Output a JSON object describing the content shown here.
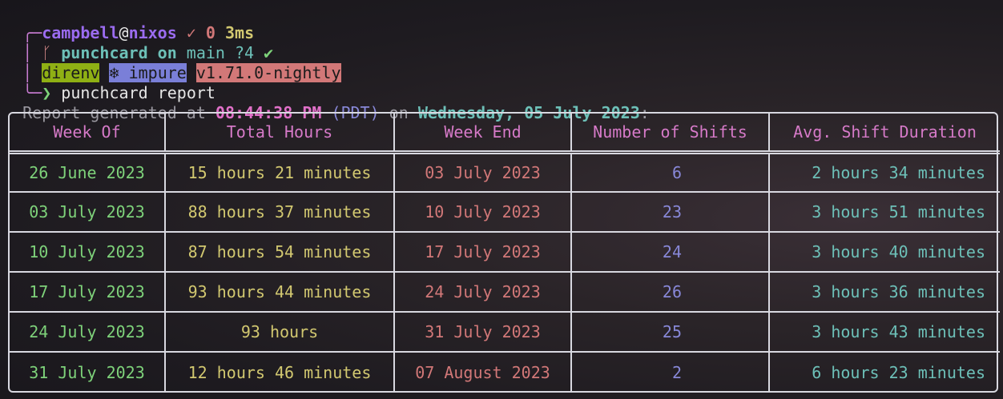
{
  "prompt": {
    "user": "campbell",
    "at": "@",
    "host": "nixos",
    "status_check": "✓",
    "exit_code": "0",
    "duration": "3ms",
    "branch_icon": "branch-icon",
    "dir": "punchcard",
    "on": "on",
    "branch": "main",
    "git_status": "?4",
    "git_clean": "✔",
    "tag_direnv": "direnv",
    "tag_nix_icon": "❄",
    "tag_nix": "impure",
    "tag_version": "v1.71.0-nightly",
    "arrow": "❯",
    "command": "punchcard report"
  },
  "report": {
    "prefix": "Report generated at ",
    "time": "08:44:38 PM",
    "tz": "(PDT)",
    "on": " on ",
    "date": "Wednesday, 05 July 2023",
    "colon": ":"
  },
  "table": {
    "headers": [
      "Week Of",
      "Total Hours",
      "Week End",
      "Number of Shifts",
      "Avg. Shift Duration"
    ],
    "rows": [
      [
        "26 June 2023",
        "15 hours 21 minutes",
        "03 July 2023",
        "6",
        "2 hours 34 minutes"
      ],
      [
        "03 July 2023",
        "88 hours 37 minutes",
        "10 July 2023",
        "23",
        "3 hours 51 minutes"
      ],
      [
        "10 July 2023",
        "87 hours 54 minutes",
        "17 July 2023",
        "24",
        "3 hours 40 minutes"
      ],
      [
        "17 July 2023",
        "93 hours 44 minutes",
        "24 July 2023",
        "26",
        "3 hours 36 minutes"
      ],
      [
        "24 July 2023",
        "93 hours",
        "31 July 2023",
        "25",
        "3 hours 43 minutes"
      ],
      [
        "31 July 2023",
        "12 hours 46 minutes",
        "07 August 2023",
        "2",
        "6 hours 23 minutes"
      ]
    ]
  }
}
